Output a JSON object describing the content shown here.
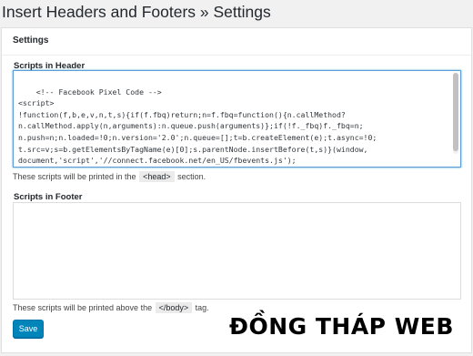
{
  "page": {
    "title": "Insert Headers and Footers » Settings"
  },
  "panel": {
    "title": "Settings"
  },
  "header_scripts": {
    "label": "Scripts in Header",
    "value": "<!-- Facebook Pixel Code -->\n<script>\n!function(f,b,e,v,n,t,s){if(f.fbq)return;n=f.fbq=function(){n.callMethod?\nn.callMethod.apply(n,arguments):n.queue.push(arguments)};if(!f._fbq)f._fbq=n;\nn.push=n;n.loaded=!0;n.version='2.0';n.queue=[];t=b.createElement(e);t.async=!0;\nt.src=v;s=b.getElementsByTagName(e)[0];s.parentNode.insertBefore(t,s)}(window,\ndocument,'script','//connect.facebook.net/en_US/fbevents.js');",
    "help_before": "These scripts will be printed in the ",
    "help_tag": "<head>",
    "help_after": " section."
  },
  "footer_scripts": {
    "label": "Scripts in Footer",
    "value": "",
    "help_before": "These scripts will be printed above the ",
    "help_tag": "</body>",
    "help_after": " tag."
  },
  "actions": {
    "save_label": "Save"
  },
  "watermark": {
    "text": "ĐỒNG THÁP WEB"
  },
  "colors": {
    "primary_button": "#0085ba",
    "focus_border": "#5b9dd9",
    "background": "#f1f1f1",
    "panel": "#ffffff"
  }
}
